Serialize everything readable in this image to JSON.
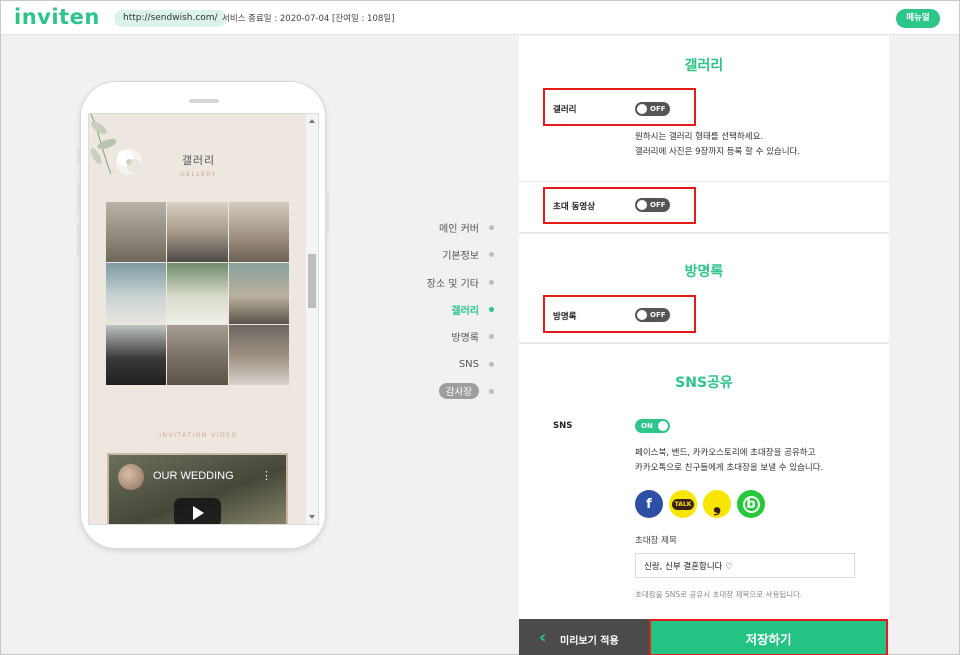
{
  "header": {
    "logo": "inviten",
    "url": "http://sendwish.com/",
    "service_end": "서비스 종료일 : 2020-07-04 [잔여일 : 108일]",
    "menu_label": "메뉴얼"
  },
  "preview": {
    "gallery_title": "갤러리",
    "gallery_subtitle": "GELLERY",
    "video_label": "INVITATION VIDEO",
    "video_title": "OUR WEDDING"
  },
  "nav": {
    "items": [
      {
        "label": "메인 커버"
      },
      {
        "label": "기본정보"
      },
      {
        "label": "장소 및 기타"
      },
      {
        "label": "갤러리"
      },
      {
        "label": "방명록"
      },
      {
        "label": "SNS"
      },
      {
        "label": "감사장"
      }
    ]
  },
  "panel": {
    "gallery": {
      "title": "갤러리",
      "toggle_label": "갤러리",
      "toggle_state": "OFF",
      "desc_line1": "원하시는 갤러리 형태를 선택하세요.",
      "desc_line2": "갤러리에 사진은 9장까지 등록 할 수 있습니다."
    },
    "video": {
      "toggle_label": "초대 동영상",
      "toggle_state": "OFF"
    },
    "guestbook": {
      "title": "방명록",
      "toggle_label": "방명록",
      "toggle_state": "OFF"
    },
    "sns": {
      "title": "SNS공유",
      "toggle_label": "SNS",
      "toggle_state": "ON",
      "desc_line1": "페이스북, 밴드, 카카오스토리에 초대장을 공유하고",
      "desc_line2": "카카오톡으로 친구들에게 초대장을 보낼 수 있습니다.",
      "icons": [
        {
          "name": "facebook-icon",
          "glyph": "f",
          "color": "#2d4fa6",
          "fg": "#ffffff"
        },
        {
          "name": "kakaotalk-icon",
          "glyph": "TALK",
          "color": "#f7e600",
          "fg": "#3a1d1d"
        },
        {
          "name": "kakaostory-icon",
          "glyph": "❟",
          "color": "#f7e600",
          "fg": "#3a1d1d"
        },
        {
          "name": "band-icon",
          "glyph": "b",
          "color": "#25c93a",
          "fg": "#ffffff"
        }
      ],
      "field_label": "초대장 제목",
      "field_value": "신랑, 신부 결혼합니다 ♡",
      "hint": "초대장을 SNS로 공유시 초대장 제목으로 사용됩니다."
    }
  },
  "bottom": {
    "preview_label": "미리보기 적용",
    "save_label": "저장하기"
  },
  "colors": {
    "accent": "#2cc58a",
    "highlight": "#e41b1b"
  }
}
